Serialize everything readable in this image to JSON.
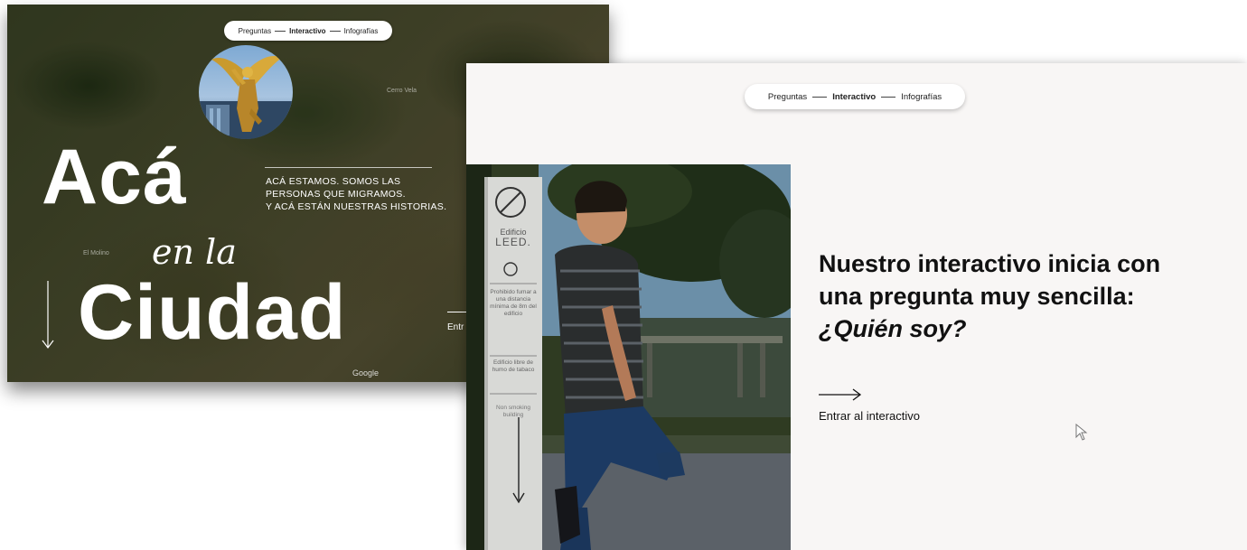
{
  "back_window": {
    "nav": {
      "item_1": "Preguntas",
      "item_2": "Interactivo",
      "item_3": "Infografías"
    },
    "hero": {
      "line_1": "Acá",
      "line_2": "en la",
      "line_3": "Ciudad"
    },
    "tagline": {
      "line_1": "ACÁ ESTAMOS. SOMOS LAS",
      "line_2": "PERSONAS QUE MIGRAMOS.",
      "line_3": "Y ACÁ ESTÁN NUESTRAS HISTORIAS."
    },
    "enter_partial": "Entr",
    "map_attribution": "Google",
    "map_labels": [
      "Cerro Vela",
      "El Molino"
    ]
  },
  "front_window": {
    "nav": {
      "item_1": "Preguntas",
      "item_2": "Interactivo",
      "item_3": "Infografías"
    },
    "headline": {
      "part_1": "Nuestro interactivo inicia con una pregunta muy sencilla: ",
      "emphasis": "¿Quién soy?"
    },
    "enter_link": "Entrar al interactivo",
    "sign": {
      "title_1": "Edificio",
      "title_2": "LEED.",
      "text_1": "Prohibido fumar a una distancia mínima de 8m del edificio",
      "text_2": "Edificio libre de humo de tabaco",
      "text_3": "Non smoking building"
    }
  },
  "colors": {
    "text_dark": "#111111",
    "front_bg": "#f8f6f5",
    "map_green": "#4b4d30"
  }
}
